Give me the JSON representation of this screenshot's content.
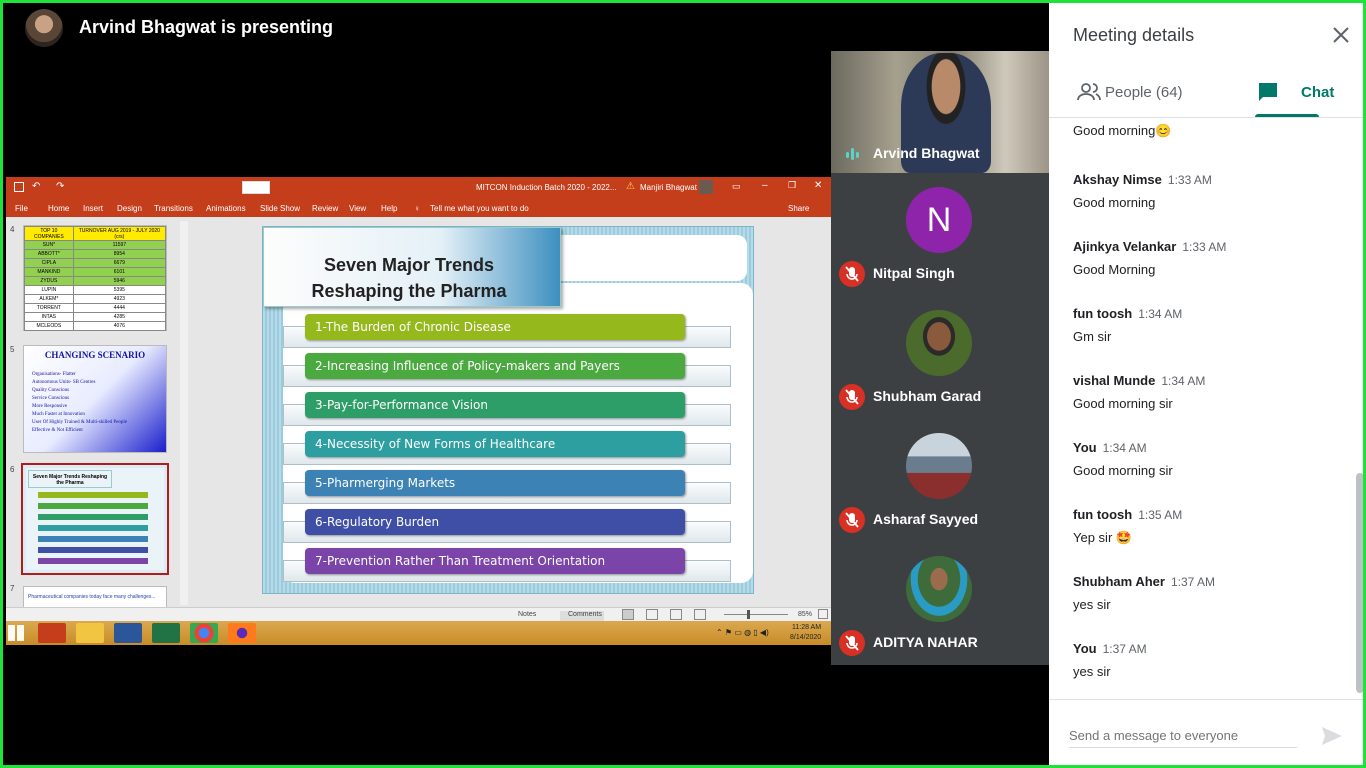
{
  "header": {
    "presenting_title": "Arvind Bhagwat is presenting"
  },
  "powerpoint": {
    "window_title": "MITCON Induction Batch 2020 - 2022...",
    "user_name": "Manjiri Bhagwat",
    "ribbon_tabs": [
      "File",
      "Home",
      "Insert",
      "Design",
      "Transitions",
      "Animations",
      "Slide Show",
      "Review",
      "View",
      "Help"
    ],
    "tell_me": "Tell me what you want to do",
    "share": "Share",
    "thumbnails": {
      "numbers": [
        "4",
        "5",
        "6",
        "7"
      ],
      "t4_header": [
        "TOP 10 COMPANIES",
        "TURNOVER AUG 2019 - JULY 2020 (crs)"
      ],
      "t4_rows": [
        [
          "SUN*",
          "11597"
        ],
        [
          "ABBOTT*",
          "8954"
        ],
        [
          "CIPLA",
          "6679"
        ],
        [
          "MANKIND",
          "6101"
        ],
        [
          "ZYDUS",
          "5946"
        ],
        [
          "LUPIN",
          "5395"
        ],
        [
          "ALKEM*",
          "4923"
        ],
        [
          "TORRENT",
          "4444"
        ],
        [
          "INTAS",
          "4285"
        ],
        [
          "MCLEODS",
          "4076"
        ]
      ],
      "t5_title": "CHANGING SCENARIO",
      "t5_lines": [
        "Organisations- Flatter",
        "Autonomous Units- SB Centres",
        "Quality Conscious",
        "Service Conscious",
        "More Responsive",
        "Much Faster at Innovation",
        "User Of Highly Trained & Multi-skilled People",
        "Effective & Not Efficient"
      ],
      "t6_title": "Seven Major Trends Reshaping the Pharma",
      "t7_text": "Pharmaceutical companies today face many challenges..."
    },
    "slide": {
      "title_line1": "Seven Major Trends",
      "title_line2": "Reshaping the Pharma",
      "trends": [
        {
          "label": "1-The Burden of Chronic Disease",
          "color": "#95b81c"
        },
        {
          "label": "2-Increasing Influence of Policy-makers and Payers",
          "color": "#4aa93f"
        },
        {
          "label": "3-Pay-for-Performance Vision",
          "color": "#2e9e68"
        },
        {
          "label": "4-Necessity of New Forms of Healthcare",
          "color": "#2e9fa1"
        },
        {
          "label": "5-Pharmerging Markets",
          "color": "#3c82b4"
        },
        {
          "label": "6-Regulatory Burden",
          "color": "#3f4fa6"
        },
        {
          "label": "7-Prevention Rather Than Treatment Orientation",
          "color": "#7a44a8"
        }
      ]
    },
    "status": {
      "notes": "Notes",
      "comments": "Comments",
      "zoom": "85%"
    },
    "taskbar": {
      "time": "11:28 AM",
      "date": "8/14/2020"
    }
  },
  "participants": {
    "video": {
      "name": "Arvind Bhagwat"
    },
    "tiles": [
      {
        "name": "Nitpal Singh",
        "initial": "N",
        "color": "#8e24aa"
      },
      {
        "name": "Shubham Garad",
        "initial": "",
        "color": "#4b6b2c"
      },
      {
        "name": "Asharaf Sayyed",
        "initial": "",
        "color": "#6a7d8f"
      },
      {
        "name": "ADITYA NAHAR",
        "initial": "",
        "color": "#3e6b3a"
      }
    ]
  },
  "panel": {
    "title": "Meeting details",
    "tabs": {
      "people": "People (64)",
      "chat": "Chat"
    },
    "messages": [
      {
        "sender": "",
        "time": "",
        "text": "Good morning😊"
      },
      {
        "sender": "Akshay Nimse",
        "time": "1:33 AM",
        "text": "Good morning"
      },
      {
        "sender": "Ajinkya Velankar",
        "time": "1:33 AM",
        "text": "Good Morning"
      },
      {
        "sender": "fun toosh",
        "time": "1:34 AM",
        "text": "Gm sir"
      },
      {
        "sender": "vishal Munde",
        "time": "1:34 AM",
        "text": "Good morning sir"
      },
      {
        "sender": "You",
        "time": "1:34 AM",
        "text": "Good morning sir"
      },
      {
        "sender": "fun toosh",
        "time": "1:35 AM",
        "text": "Yep sir 🤩"
      },
      {
        "sender": "Shubham Aher",
        "time": "1:37 AM",
        "text": "yes sir"
      },
      {
        "sender": "You",
        "time": "1:37 AM",
        "text": "yes sir"
      }
    ],
    "input_placeholder": "Send a message to everyone"
  }
}
